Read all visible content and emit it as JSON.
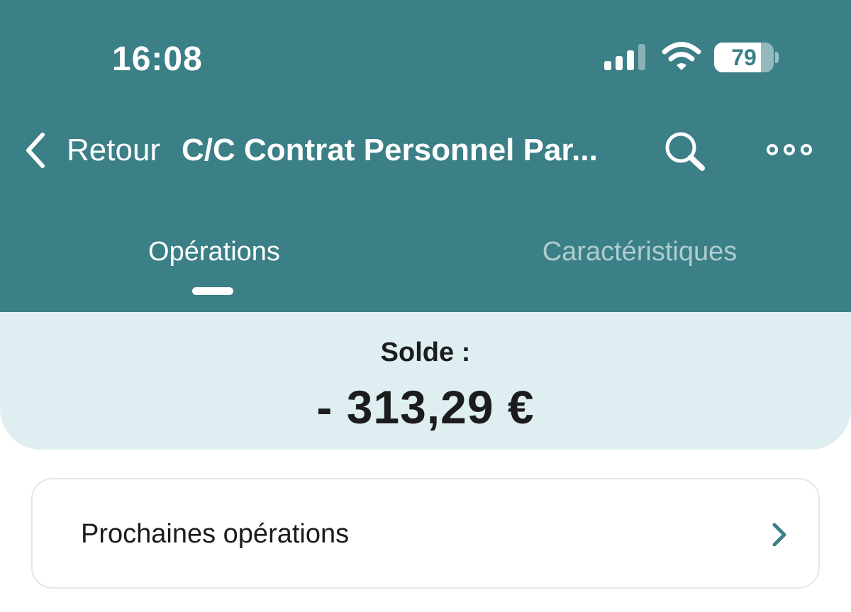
{
  "status_bar": {
    "time": "16:08",
    "battery_level": "79",
    "battery_fraction": 0.79,
    "signal_bars_active": 3,
    "signal_bars_total": 4
  },
  "nav": {
    "back_label": "Retour",
    "title": "C/C Contrat Personnel Par...",
    "back_icon": "chevron-left-icon",
    "search_icon": "magnifier-icon",
    "more_icon": "ellipsis-icon"
  },
  "tabs": [
    {
      "label": "Opérations",
      "active": true
    },
    {
      "label": "Caractéristiques",
      "active": false
    }
  ],
  "balance": {
    "label": "Solde :",
    "value": "- 313,29 €"
  },
  "upcoming": {
    "label": "Prochaines opérations",
    "chevron_icon": "chevron-right-icon"
  },
  "colors": {
    "header_bg": "#3b7f87",
    "balance_bg": "#dfeff1",
    "accent": "#3b7f87"
  }
}
